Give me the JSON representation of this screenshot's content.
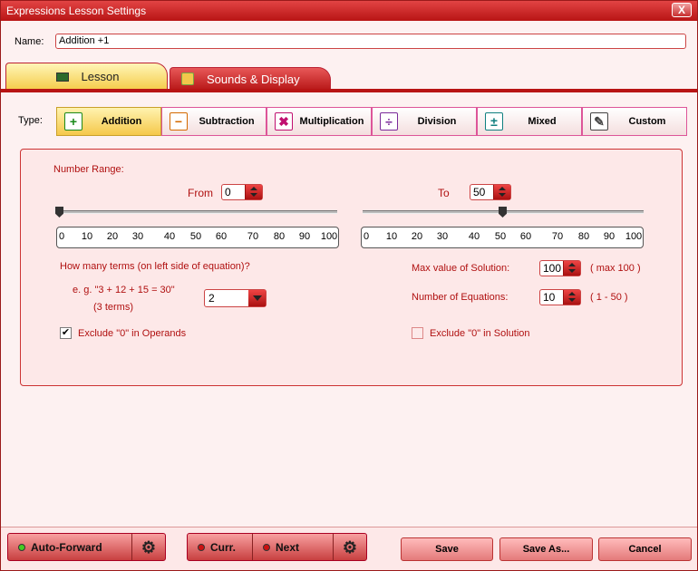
{
  "window": {
    "title": "Expressions Lesson Settings",
    "close_label": "X"
  },
  "name": {
    "label": "Name:",
    "value": "Addition +1"
  },
  "tabs": [
    {
      "label": "Lesson",
      "icon": "monitor-icon",
      "active": true
    },
    {
      "label": "Sounds & Display",
      "icon": "speaker-icon",
      "active": false
    }
  ],
  "type": {
    "label": "Type:",
    "options": [
      {
        "label": "Addition",
        "icon": "+",
        "color": "#1a8a1a",
        "active": true
      },
      {
        "label": "Subtraction",
        "icon": "−",
        "color": "#d46a00"
      },
      {
        "label": "Multiplication",
        "icon": "✖",
        "color": "#c01070"
      },
      {
        "label": "Division",
        "icon": "÷",
        "color": "#7a2a9a"
      },
      {
        "label": "Mixed",
        "icon": "±",
        "color": "#108080"
      },
      {
        "label": "Custom",
        "icon": "✎",
        "color": "#444"
      }
    ]
  },
  "range": {
    "title": "Number Range:",
    "from_label": "From",
    "from_value": "0",
    "to_label": "To",
    "to_value": "50",
    "ticks": [
      "0",
      "10",
      "20",
      "30",
      "40",
      "50",
      "60",
      "70",
      "80",
      "90",
      "100"
    ],
    "from_slider_value": 0,
    "to_slider_value": 50
  },
  "terms": {
    "question": "How many terms (on left side of equation)?",
    "example": "e. g. \"3 + 12 + 15 = 30\"",
    "example_note": "(3 terms)",
    "value": "2"
  },
  "max_solution": {
    "label": "Max value of Solution:",
    "value": "100",
    "hint": "( max 100 )"
  },
  "equations": {
    "label": "Number of Equations:",
    "value": "10",
    "hint": "( 1 - 50 )"
  },
  "exclude_operands": {
    "label": "Exclude \"0\" in Operands",
    "checked": true,
    "mark": "✔"
  },
  "exclude_solution": {
    "label": "Exclude \"0\" in Solution",
    "checked": false
  },
  "footer": {
    "auto_forward": "Auto-Forward",
    "curr": "Curr.",
    "next": "Next",
    "save": "Save",
    "save_as": "Save As...",
    "cancel": "Cancel"
  }
}
